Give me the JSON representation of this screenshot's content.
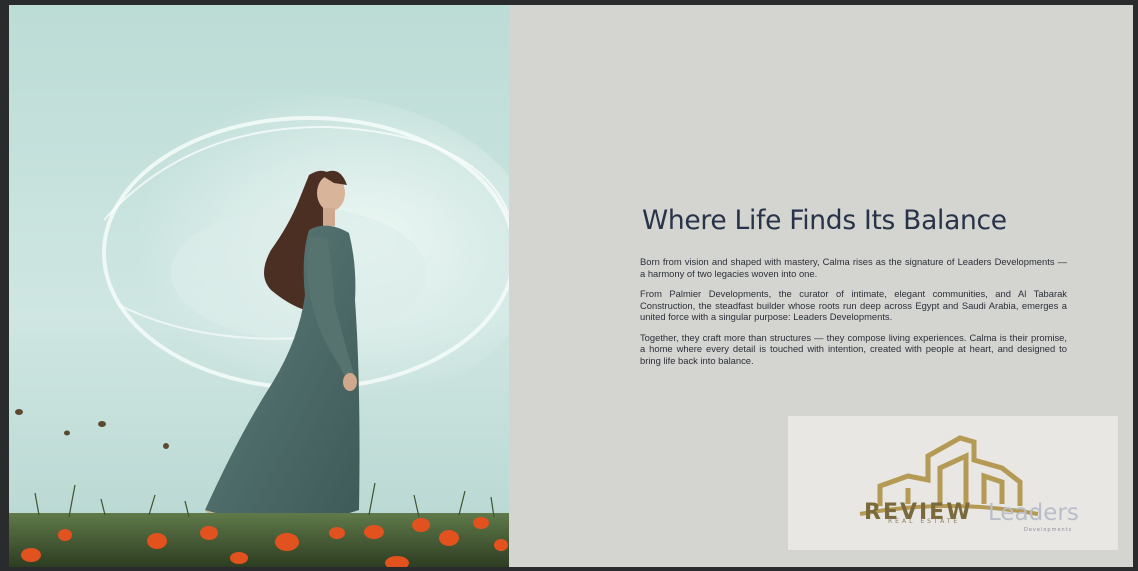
{
  "headline": "Where Life Finds Its Balance",
  "paragraphs": [
    "Born from vision and shaped with mastery, Calma rises as the signature of Leaders Developments — a harmony of two legacies woven into one.",
    "From Palmier Developments, the curator of intimate, elegant communities, and Al Tabarak Construction, the steadfast builder whose roots run deep across Egypt and Saudi Arabia, emerges a united force with a singular purpose: Leaders Developments.",
    "Together, they craft more than structures — they compose living experiences. Calma is their promise, a home where every detail is touched with intention, created with people at heart, and designed to bring life back into balance."
  ],
  "logo": {
    "watermark": "REVIEW",
    "watermark_sub": "REAL ESTATE",
    "brand": "Leaders",
    "brand_sub": "Developments"
  },
  "colors": {
    "background": "#d4d5d0",
    "headline": "#283349",
    "body_text": "#2b2f3a",
    "accent_gold": "#b59a55"
  }
}
